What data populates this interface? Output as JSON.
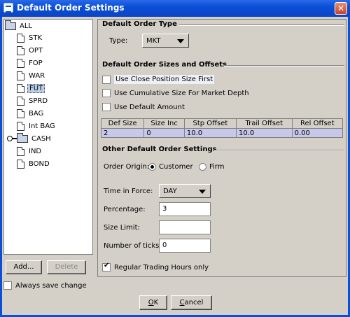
{
  "window": {
    "title": "Default Order Settings",
    "close_glyph": "✕"
  },
  "tree": {
    "items": [
      {
        "label": "ALL"
      },
      {
        "label": "STK"
      },
      {
        "label": "OPT"
      },
      {
        "label": "FOP"
      },
      {
        "label": "WAR"
      },
      {
        "label": "FUT"
      },
      {
        "label": "SPRD"
      },
      {
        "label": "BAG"
      },
      {
        "label": "Int BAG"
      },
      {
        "label": "CASH"
      },
      {
        "label": "IND"
      },
      {
        "label": "BOND"
      }
    ],
    "selected": "FUT"
  },
  "left_buttons": {
    "add": "Add...",
    "delete": "Delete"
  },
  "always_save": "Always save change",
  "order_type": {
    "section_title": "Default Order Type",
    "type_label": "Type:",
    "type_value": "MKT"
  },
  "sizes": {
    "section_title": "Default Order Sizes and Offsets",
    "use_close_position": "Use Close Position Size First",
    "use_cumulative": "Use Cumulative Size For Market Depth",
    "use_default_amount": "Use Default Amount",
    "columns": [
      "Def Size",
      "Size Inc",
      "Stp Offset",
      "Trail Offset",
      "Rel Offset"
    ],
    "row": [
      "2",
      "0",
      "10.0",
      "10.0",
      "0.00"
    ]
  },
  "other": {
    "section_title": "Other Default Order Settings",
    "order_origin_label": "Order Origin:",
    "origin_customer": "Customer",
    "origin_firm": "Firm",
    "tif_label": "Time in Force:",
    "tif_value": "DAY",
    "percentage_label": "Percentage:",
    "percentage_value": "3",
    "size_limit_label": "Size Limit:",
    "size_limit_value": "",
    "ticks_label": "Number of ticks:",
    "ticks_value": "0",
    "rth_only": "Regular Trading Hours only"
  },
  "dialog_buttons": {
    "ok_key": "O",
    "ok_rest": "K",
    "cancel_key": "C",
    "cancel_rest": "ancel"
  }
}
